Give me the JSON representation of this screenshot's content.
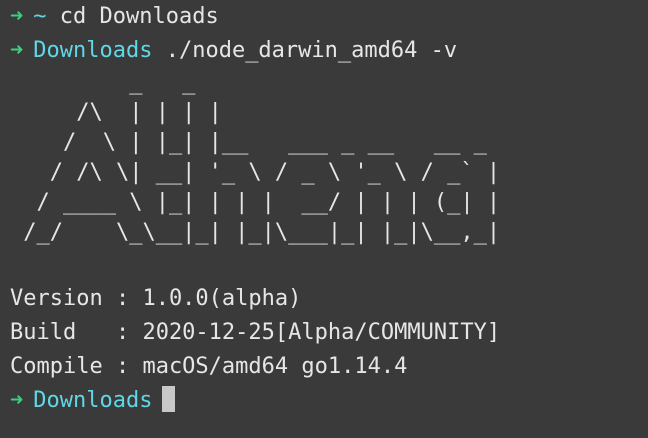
{
  "prompt": {
    "arrow": "➜",
    "home_dir": "~",
    "cwd": "Downloads"
  },
  "history": [
    {
      "dir": "~",
      "command": "cd Downloads"
    },
    {
      "dir": "Downloads",
      "command": "./node_darwin_amd64 -v"
    }
  ],
  "banner_ascii": "         _   _\n     /\\  | | | |\n    /  \\ | |_| |__   ___ _ __   __ _\n   / /\\ \\| __| '_ \\ / _ \\ '_ \\ / _` |\n  / ____ \\ |_| | | |  __/ | | | (_| |\n /_/    \\_\\__|_| |_|\\___|_| |_|\\__,_|",
  "info": {
    "version_line": "Version : 1.0.0(alpha)",
    "build_line": "Build   : 2020-12-25[Alpha/COMMUNITY]",
    "compile_line": "Compile : macOS/amd64 go1.14.4"
  },
  "current": {
    "dir": "Downloads"
  },
  "colors": {
    "background": "#3a3a3a",
    "arrow": "#37d27a",
    "directory": "#5fd7e6",
    "text": "#e6e6e6"
  }
}
